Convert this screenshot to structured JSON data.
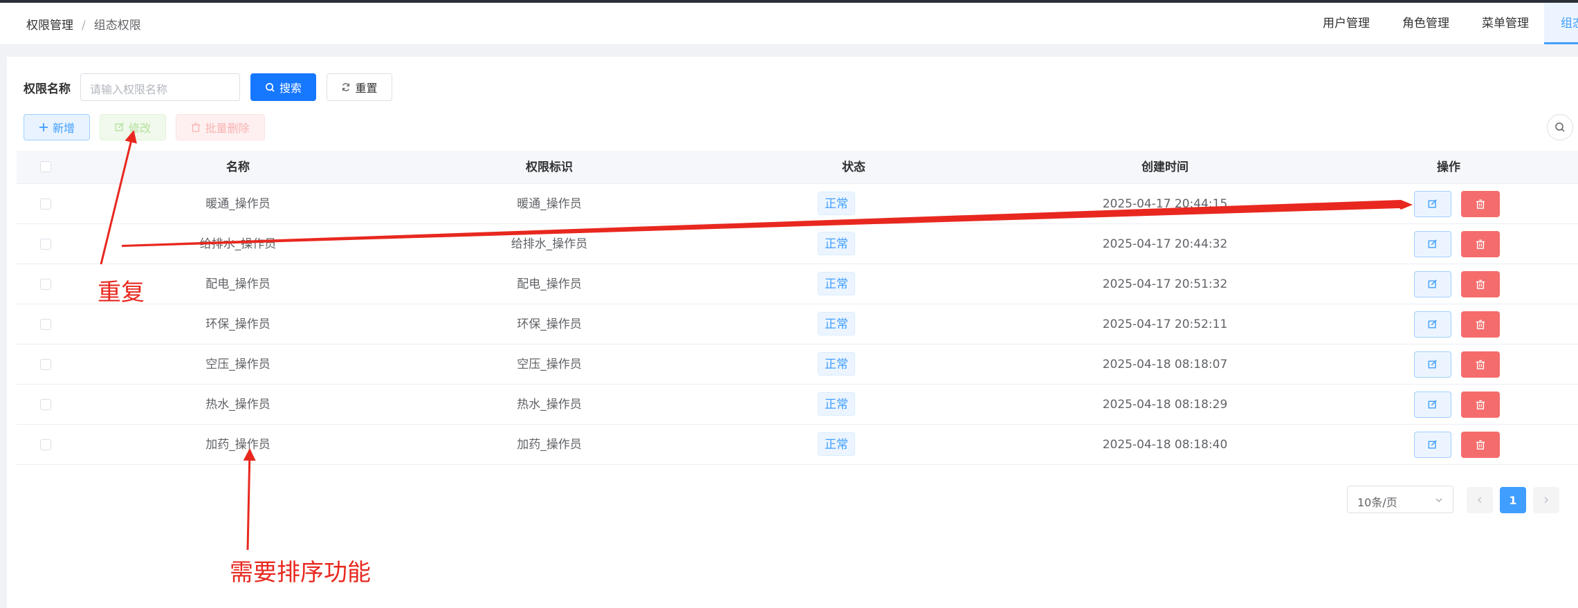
{
  "breadcrumb": {
    "items": [
      "权限管理",
      "组态权限"
    ],
    "separator": "/"
  },
  "tabs": [
    {
      "label": "用户管理"
    },
    {
      "label": "角色管理"
    },
    {
      "label": "菜单管理"
    },
    {
      "label": "组态权限",
      "active": true
    }
  ],
  "search": {
    "label": "权限名称",
    "placeholder": "请输入权限名称",
    "search_btn": "搜索",
    "reset_btn": "重置"
  },
  "toolbar": {
    "add": "新增",
    "edit": "修改",
    "batch_delete": "批量删除"
  },
  "table": {
    "columns": [
      "名称",
      "权限标识",
      "状态",
      "创建时间",
      "操作"
    ],
    "rows": [
      {
        "name": "暖通_操作员",
        "perm": "暖通_操作员",
        "status": "正常",
        "created": "2025-04-17 20:44:15"
      },
      {
        "name": "给排水_操作员",
        "perm": "给排水_操作员",
        "status": "正常",
        "created": "2025-04-17 20:44:32"
      },
      {
        "name": "配电_操作员",
        "perm": "配电_操作员",
        "status": "正常",
        "created": "2025-04-17 20:51:32"
      },
      {
        "name": "环保_操作员",
        "perm": "环保_操作员",
        "status": "正常",
        "created": "2025-04-17 20:52:11"
      },
      {
        "name": "空压_操作员",
        "perm": "空压_操作员",
        "status": "正常",
        "created": "2025-04-18 08:18:07"
      },
      {
        "name": "热水_操作员",
        "perm": "热水_操作员",
        "status": "正常",
        "created": "2025-04-18 08:18:29"
      },
      {
        "name": "加药_操作员",
        "perm": "加药_操作员",
        "status": "正常",
        "created": "2025-04-18 08:18:40"
      }
    ]
  },
  "pagination": {
    "page_size": "10条/页",
    "current_page": "1"
  },
  "annotations": {
    "duplicate": "重复",
    "need_sort": "需要排序功能"
  },
  "colors": {
    "primary": "#1677ff",
    "accent": "#409eff",
    "danger": "#f56c6c",
    "annotation": "#e8281f"
  },
  "icons": [
    "search-icon",
    "refresh-icon",
    "plus-icon",
    "edit-icon",
    "delete-icon",
    "chevron-down-icon",
    "chevron-left-icon",
    "chevron-right-icon"
  ]
}
